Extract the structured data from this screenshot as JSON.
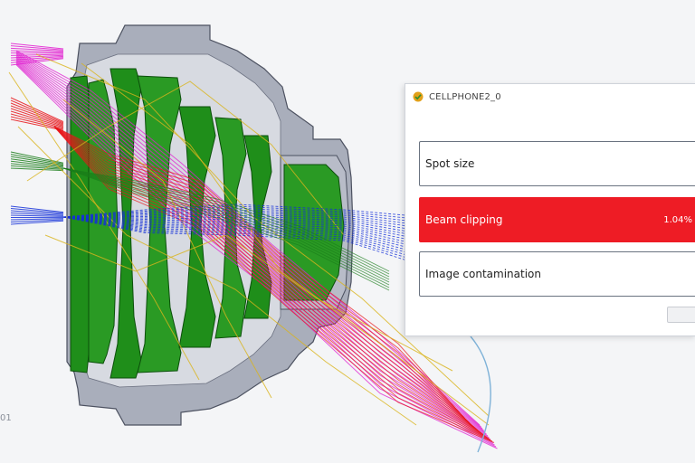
{
  "viewport": {
    "corner_label": "01",
    "colors": {
      "background": "#f4f5f7",
      "housing": "#a9aebb",
      "housing_edge": "#4c5160",
      "lens": "#1f8e1a",
      "lens_edge": "#0b4f0a",
      "ray_magenta": "#e01fd0",
      "ray_red": "#e8151a",
      "ray_green": "#1a7d1a",
      "ray_blue": "#1430d8",
      "ray_yellow": "#d9b41c"
    }
  },
  "panel": {
    "title": "CELLPHONE2_0",
    "app_icon": "cellphone-app-icon",
    "metrics": [
      {
        "label": "Spot size",
        "value": "",
        "state": "normal"
      },
      {
        "label": "Beam clipping",
        "value": "1.04%",
        "state": "alert",
        "color": "#ee1c25"
      },
      {
        "label": "Image contamination",
        "value": "",
        "state": "normal"
      }
    ],
    "button_label": ""
  }
}
